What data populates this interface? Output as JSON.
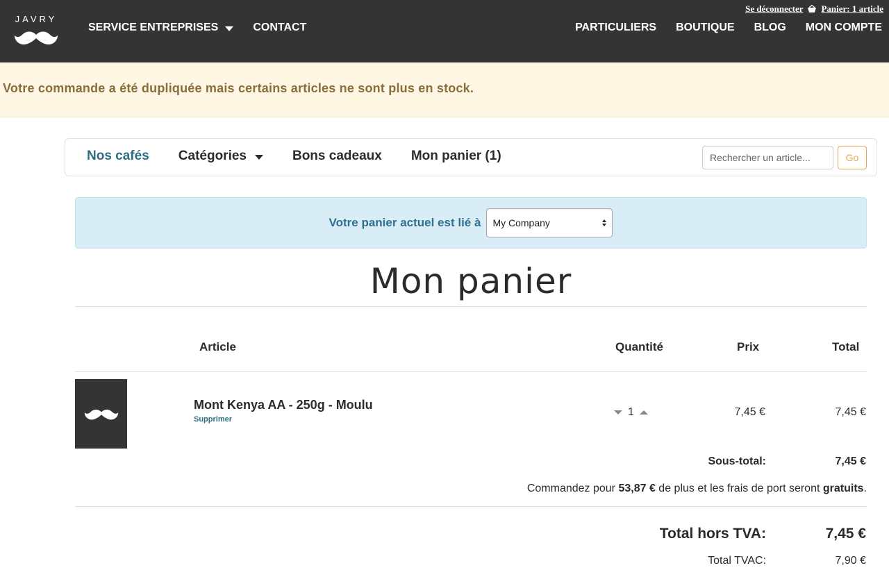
{
  "header": {
    "logo_text": "JAVRY",
    "nav_left": [
      {
        "label": "SERVICE ENTREPRISES"
      },
      {
        "label": "CONTACT"
      }
    ],
    "nav_right": [
      {
        "label": "PARTICULIERS"
      },
      {
        "label": "BOUTIQUE"
      },
      {
        "label": "BLOG"
      },
      {
        "label": "MON COMPTE"
      }
    ],
    "logout_label": "Se déconnecter",
    "basket_label": "Panier: 1 article"
  },
  "flash": {
    "message": "Votre commande a été dupliquée mais certains articles ne sont plus en stock."
  },
  "shop_nav": {
    "links": [
      {
        "label": "Nos cafés"
      },
      {
        "label": "Catégories"
      },
      {
        "label": "Bons cadeaux"
      },
      {
        "label": "Mon panier (1)"
      }
    ],
    "search_placeholder": "Rechercher un article...",
    "search_button": "Go"
  },
  "linked_company": {
    "text": "Votre panier actuel est lié à",
    "selected": "My Company"
  },
  "cart": {
    "title": "Mon panier",
    "columns": {
      "article": "Article",
      "quantity": "Quantité",
      "price": "Prix",
      "total": "Total"
    },
    "items": [
      {
        "name": "Mont Kenya AA - 250g - Moulu",
        "remove_label": "Supprimer",
        "quantity": "1",
        "price": "7,45 €",
        "total": "7,45 €"
      }
    ],
    "subtotal_label": "Sous-total:",
    "subtotal_value": "7,45 €",
    "shipping_note": {
      "prefix": "Commandez pour",
      "amount": "53,87 €",
      "middle": "de plus et les frais de port seront",
      "free": "gratuits",
      "suffix": "."
    },
    "total_ht_label": "Total hors TVA:",
    "total_ht_value": "7,45 €",
    "total_tvac_label": "Total TVAC:",
    "total_tvac_value": "7,90 €"
  },
  "colors": {
    "header_bg": "#343434",
    "flash_bg": "#fdf7e3",
    "flash_text": "#8a6d3b",
    "accent_teal": "#2c6e7f",
    "accent_orange": "#e3a857",
    "info_bg": "#d9edf7"
  }
}
